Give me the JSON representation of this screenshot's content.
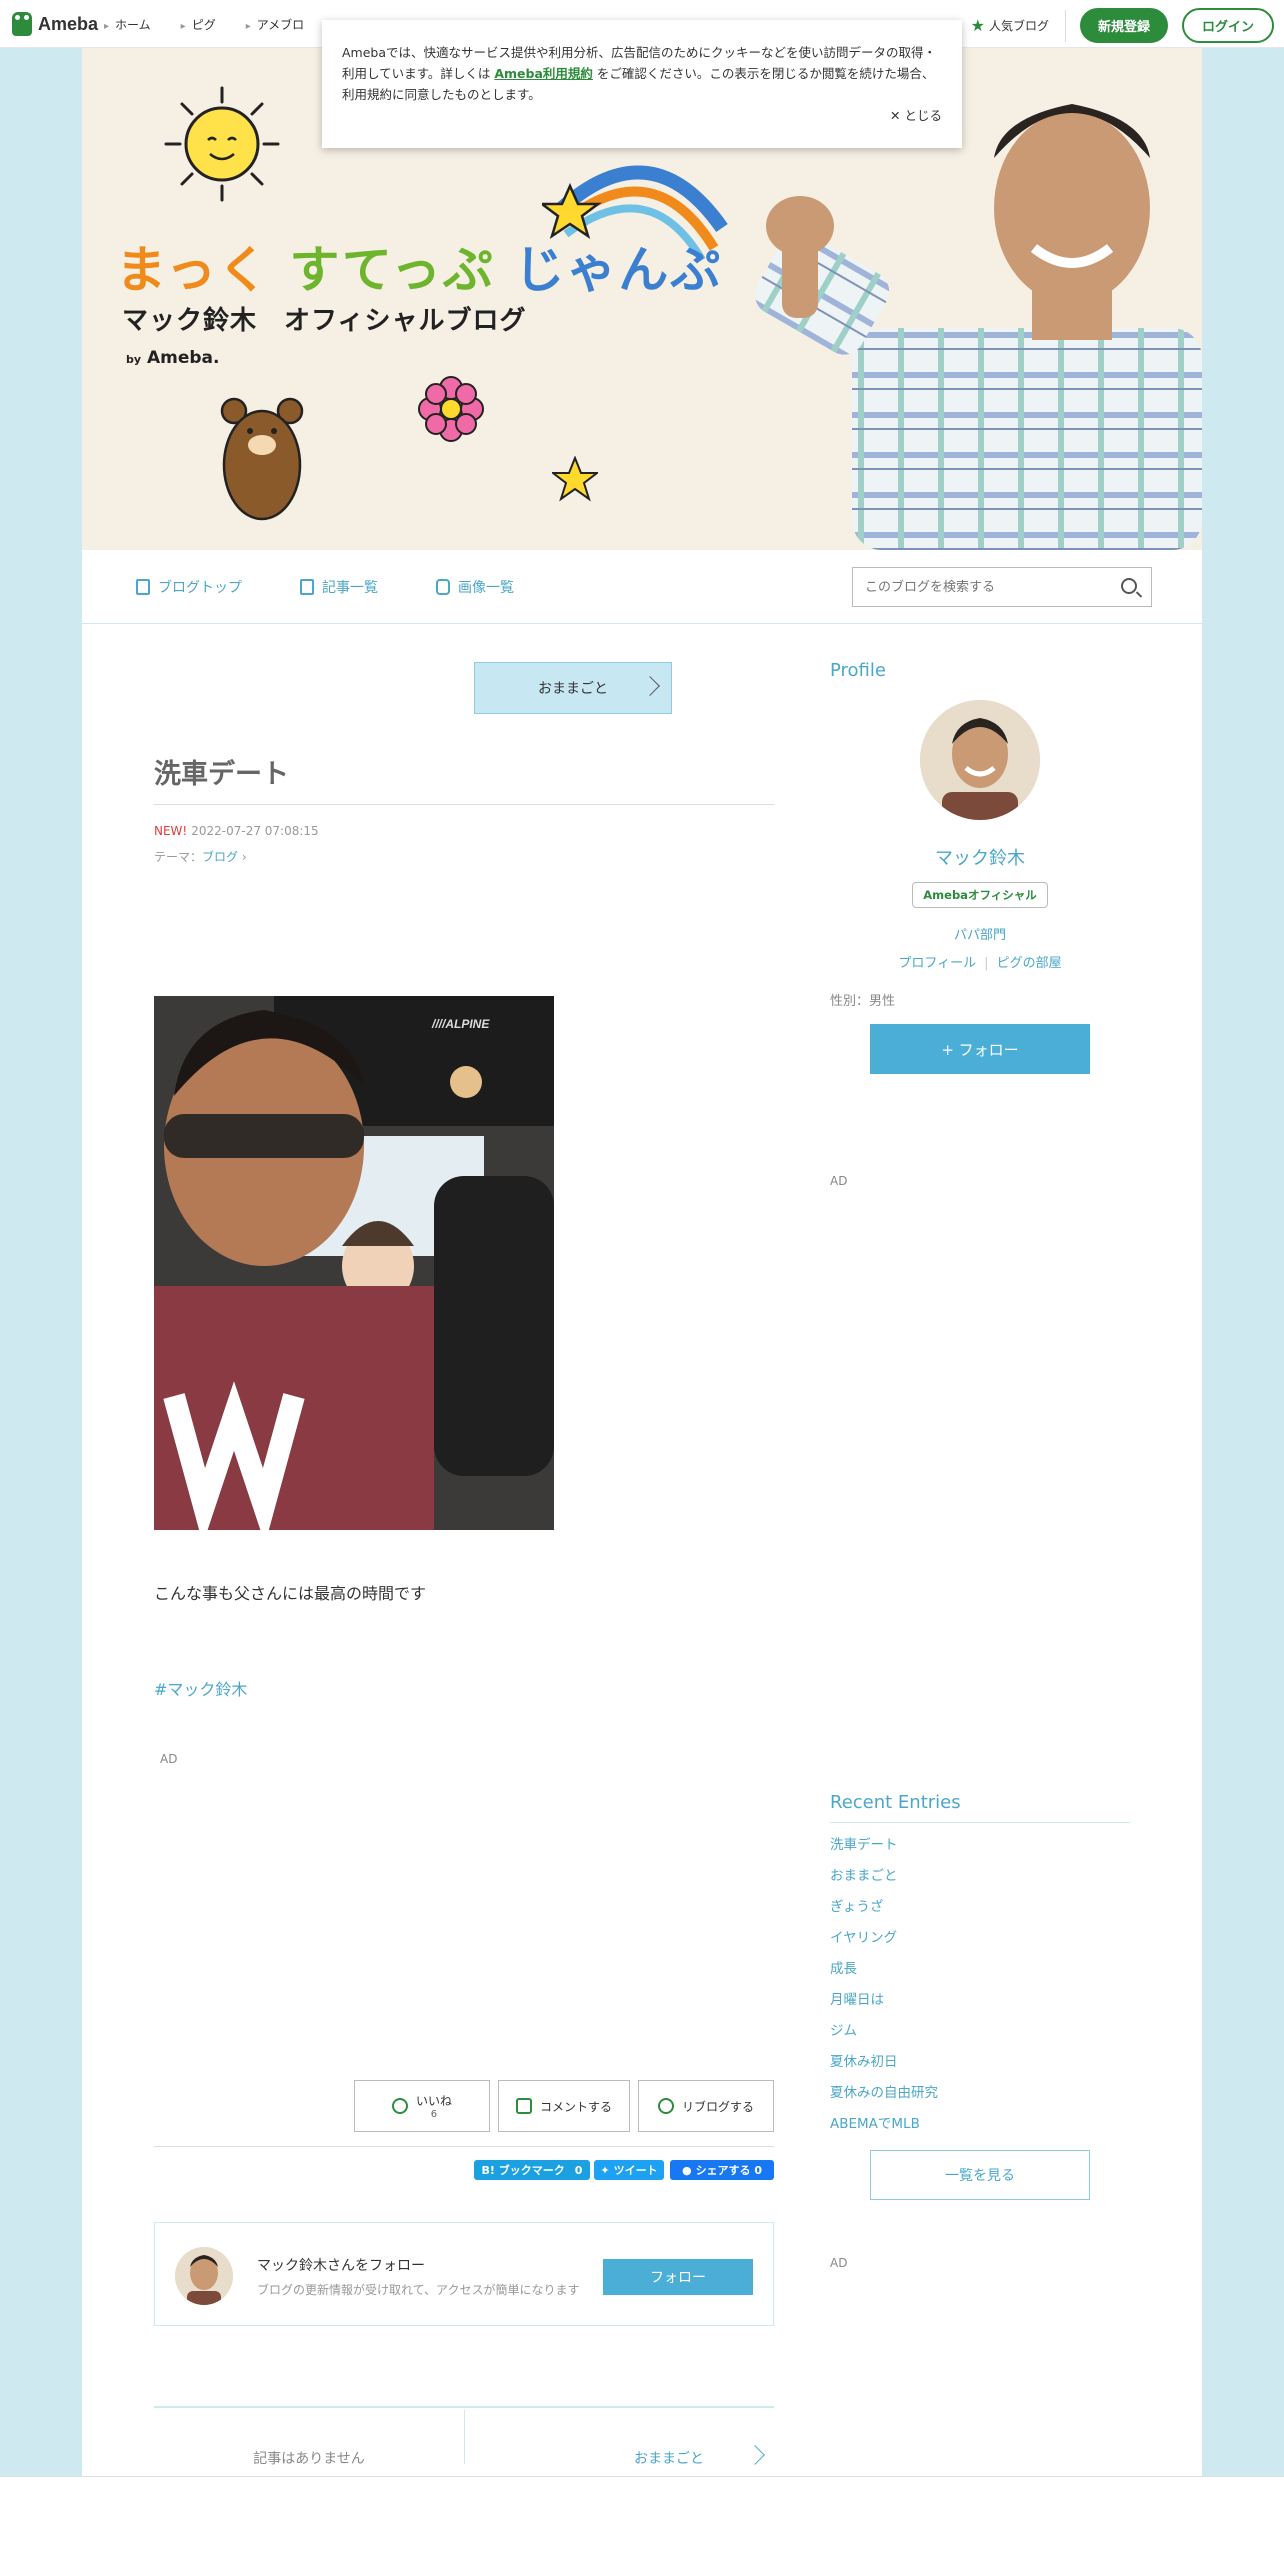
{
  "global_header": {
    "logo": "Ameba",
    "nav": [
      "ホーム",
      "ピグ",
      "アメブロ"
    ],
    "popular_blog": "人気ブログ",
    "signup": "新規登録",
    "login": "ログイン",
    "colors": {
      "brand": "#2d8c3c",
      "accent": "#4aaed6"
    }
  },
  "cookie_notice": {
    "text_before": "Amebaでは、快適なサービス提供や利用分析、広告配信のためにクッキーなどを使い訪問データの取得・利用しています。詳しくは ",
    "link": "Ameba利用規約",
    "text_after": " をご確認ください。この表示を閉じるか閲覧を続けた場合、利用規約に同意したものとします。",
    "close": "とじる"
  },
  "banner": {
    "title_part1": "まっく ",
    "title_part2": "すてっぷ ",
    "title_part3": "じゃんぷ",
    "subtitle": "マック鈴木　オフィシャルブログ",
    "by": "by",
    "by_brand": "Ameba."
  },
  "blog_nav": {
    "items": [
      "ブログトップ",
      "記事一覧",
      "画像一覧"
    ],
    "search_placeholder": "このブログを検索する"
  },
  "article": {
    "theme_button": "おままごと",
    "title": "洗車デート",
    "new_label": "NEW!",
    "datetime": "2022-07-27 07:08:15",
    "theme_label": "テーマ：",
    "theme_value": "ブログ",
    "body": "こんな事も父さんには最高の時間です",
    "hashtag": "#マック鈴木",
    "ad": "AD",
    "like_label": "いいね",
    "like_count": "6",
    "comment_label": "コメントする",
    "reblog_label": "リブログする",
    "share": {
      "bookmark": "B! ブックマーク",
      "bookmark_count": "0",
      "tweet": "ツイート",
      "facebook": "シェアする 0"
    },
    "follow_box": {
      "title": "マック鈴木さんをフォロー",
      "sub": "ブログの更新情報が受け取れて、アクセスが簡単になります",
      "button": "フォロー"
    },
    "pager": {
      "prev": "記事はありません",
      "next": "おままごと"
    }
  },
  "sidebar": {
    "profile_heading": "Profile",
    "name": "マック鈴木",
    "badge": "Amebaオフィシャル",
    "category": "パパ部門",
    "link_profile": "プロフィール",
    "link_room": "ピグの部屋",
    "sex": "性別：男性",
    "follow": "+ フォロー",
    "ad": "AD",
    "recent_heading": "Recent Entries",
    "recent": [
      "洗車デート",
      "おままごと",
      "ぎょうざ",
      "イヤリング",
      "成長",
      "月曜日は",
      "ジム",
      "夏休み初日",
      "夏休みの自由研究",
      "ABEMAでMLB"
    ],
    "see_all": "一覧を見る"
  }
}
